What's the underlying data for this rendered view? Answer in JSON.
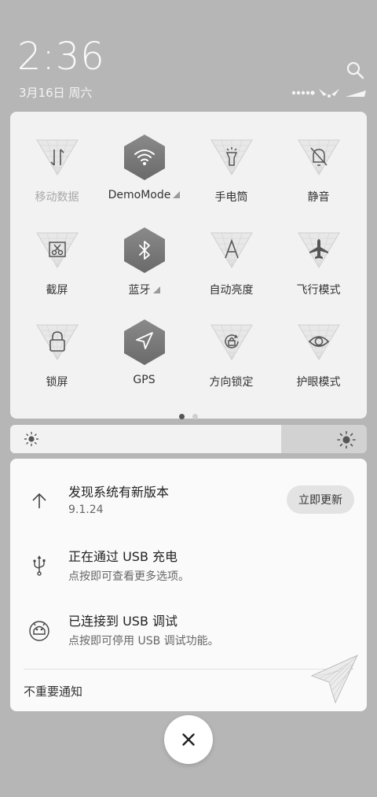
{
  "status": {
    "time": "2:36",
    "date": "3月16日 周六"
  },
  "quick_settings": {
    "tiles": [
      {
        "label": "移动数据",
        "icon": "mobile-data-icon",
        "state": "off-disabled"
      },
      {
        "label": "DemoMode",
        "icon": "wifi-icon",
        "state": "on",
        "expandable": true
      },
      {
        "label": "手电筒",
        "icon": "flashlight-icon",
        "state": "off"
      },
      {
        "label": "静音",
        "icon": "mute-icon",
        "state": "off"
      },
      {
        "label": "截屏",
        "icon": "screenshot-icon",
        "state": "off"
      },
      {
        "label": "蓝牙",
        "icon": "bluetooth-icon",
        "state": "on",
        "expandable": true
      },
      {
        "label": "自动亮度",
        "icon": "auto-brightness-icon",
        "state": "off"
      },
      {
        "label": "飞行模式",
        "icon": "airplane-icon",
        "state": "off"
      },
      {
        "label": "锁屏",
        "icon": "lock-icon",
        "state": "off"
      },
      {
        "label": "GPS",
        "icon": "location-icon",
        "state": "on"
      },
      {
        "label": "方向锁定",
        "icon": "rotation-lock-icon",
        "state": "off"
      },
      {
        "label": "护眼模式",
        "icon": "eye-icon",
        "state": "off"
      }
    ],
    "page_indicator": {
      "current": 1,
      "total": 2
    }
  },
  "brightness": {
    "level": 0.76
  },
  "notifications": {
    "items": [
      {
        "title": "发现系统有新版本",
        "subtitle": "9.1.24",
        "icon": "update-arrow-icon",
        "action_label": "立即更新"
      },
      {
        "title": "正在通过 USB 充电",
        "subtitle": "点按即可查看更多选项。",
        "icon": "usb-icon"
      },
      {
        "title": "已连接到 USB 调试",
        "subtitle": "点按即可停用 USB 调试功能。",
        "icon": "android-debug-icon"
      }
    ],
    "unimportant_label": "不重要通知"
  },
  "colors": {
    "background": "#b6b6b6",
    "panel": "#f2f2f2",
    "active_tile": "#7b7b7b"
  }
}
